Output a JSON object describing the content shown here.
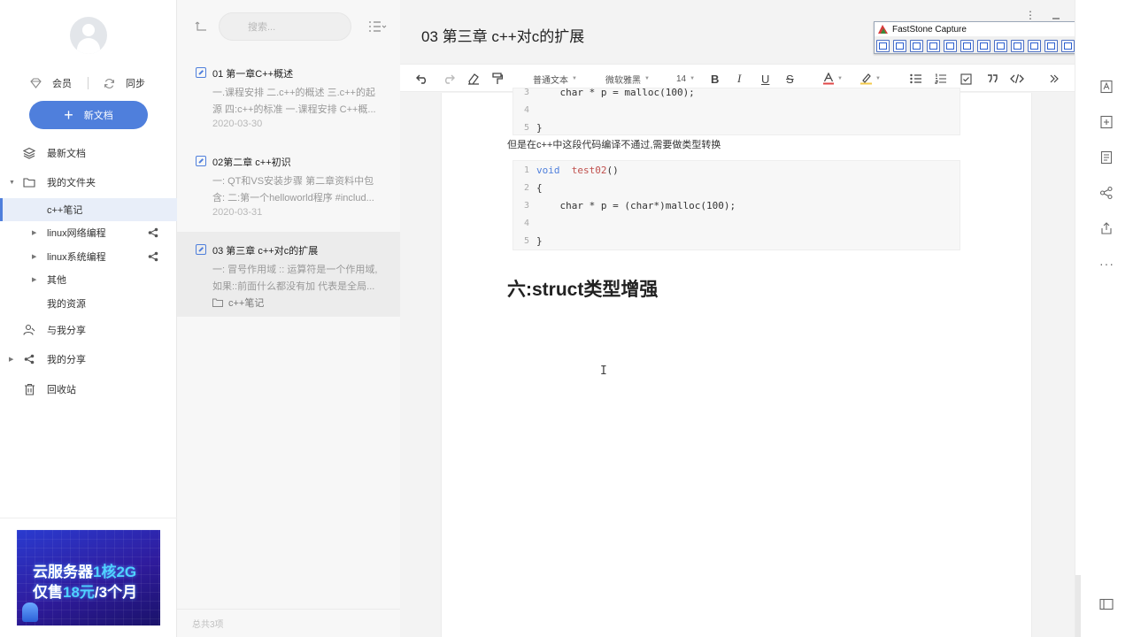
{
  "sidebar": {
    "vip_label": "会员",
    "sync_label": "同步",
    "new_doc_label": "新文档",
    "items": [
      {
        "label": "最新文档"
      },
      {
        "label": "我的文件夹"
      },
      {
        "label": "c++笔记"
      },
      {
        "label": "linux网络编程"
      },
      {
        "label": "linux系统编程"
      },
      {
        "label": "其他"
      },
      {
        "label": "我的资源"
      },
      {
        "label": "与我分享"
      },
      {
        "label": "我的分享"
      },
      {
        "label": "回收站"
      }
    ],
    "ad": {
      "line1_a": "云服务器",
      "line1_b": "1核2G",
      "line2_a": "仅售",
      "line2_b": "18元",
      "line2_c": "/3个月"
    }
  },
  "notelist": {
    "search_placeholder": "搜索...",
    "notes": [
      {
        "title": "01 第一章C++概述",
        "summary": "一.课程安排 二.c++的概述 三.c++的起源 四:c++的标准 一.课程安排 C++概...",
        "date": "2020-03-30"
      },
      {
        "title": "02第二章 c++初识",
        "summary": "一: QT和VS安装步骤 第二章资料中包含: 二:第一个helloworld程序 #includ...",
        "date": "2020-03-31"
      },
      {
        "title": "03 第三章 c++对c的扩展",
        "summary": "一: 冒号作用域 :: 运算符是一个作用域, 如果::前面什么都没有加 代表是全局...",
        "folder": "c++笔记"
      }
    ],
    "footer": "总共3项"
  },
  "editor": {
    "title": "03 第三章 c++对c的扩展",
    "toolbar": {
      "style": "普通文本",
      "font": "微软雅黑",
      "size": "14"
    },
    "code_top": {
      "lines": [
        {
          "num": "3",
          "code": "    char * p = malloc(100);"
        },
        {
          "num": "4",
          "code": ""
        },
        {
          "num": "5",
          "code": "}"
        }
      ]
    },
    "paragraph": "但是在c++中这段代码编译不通过,需要做类型转换",
    "code_main": {
      "lines": [
        {
          "num": "1",
          "kw": "void",
          "fn": "test02",
          "rest": "()"
        },
        {
          "num": "2",
          "code": "{"
        },
        {
          "num": "3",
          "code": "    char * p = (char*)malloc(100);"
        },
        {
          "num": "4",
          "code": ""
        },
        {
          "num": "5",
          "code": "}"
        }
      ]
    },
    "heading": "六:struct类型增强"
  },
  "faststone": {
    "title": "FastStone Capture"
  }
}
